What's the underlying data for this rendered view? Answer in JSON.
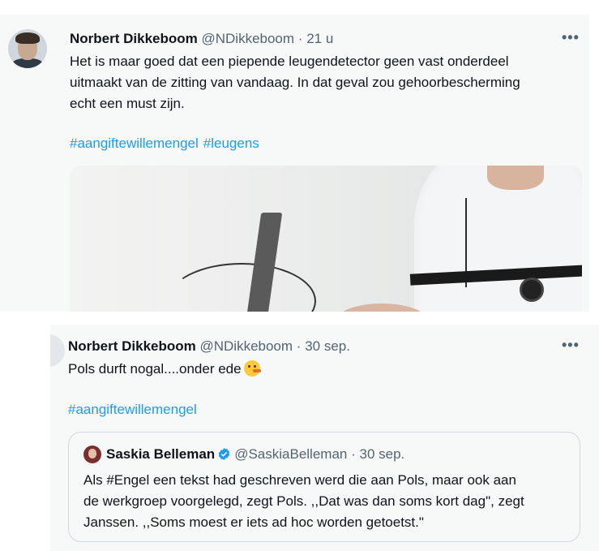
{
  "tweet1": {
    "author_name": "Norbert Dikkeboom",
    "author_handle": "@NDikkeboom",
    "separator": "·",
    "time": "21 u",
    "text_lines": [
      "Het is maar goed dat een piepende leugendetector geen vast onderdeel",
      "uitmaakt van de zitting van vandaag. In dat geval zou gehoorbescherming",
      "echt een must zijn."
    ],
    "hashtags": [
      "#aangiftewillemengel",
      "#leugens"
    ],
    "more_label": "•••"
  },
  "tweet2": {
    "author_name": "Norbert Dikkeboom",
    "author_handle": "@NDikkeboom",
    "separator": "·",
    "time": "30 sep.",
    "text": "Pols durft nogal....onder ede",
    "emoji_icon": "thinking-face-icon",
    "hashtags": [
      "#aangiftewillemengel"
    ],
    "more_label": "•••",
    "quote": {
      "author_name": "Saskia Belleman",
      "verified_icon": "verified-badge-icon",
      "author_handle": "@SaskiaBelleman",
      "separator": "·",
      "time": "30 sep.",
      "text_lines": [
        "Als #Engel een tekst had geschreven werd die aan Pols, maar ook aan",
        "de werkgroep voorgelegd, zegt Pols. ,,Dat was dan soms kort dag\", zegt",
        "Janssen. ,,Soms moest er iets ad hoc worden getoetst.\""
      ]
    }
  },
  "colors": {
    "link": "#1d9bf0",
    "secondary_text": "#536471",
    "card_background": "#f7f9f9",
    "border": "#cfd9de"
  }
}
